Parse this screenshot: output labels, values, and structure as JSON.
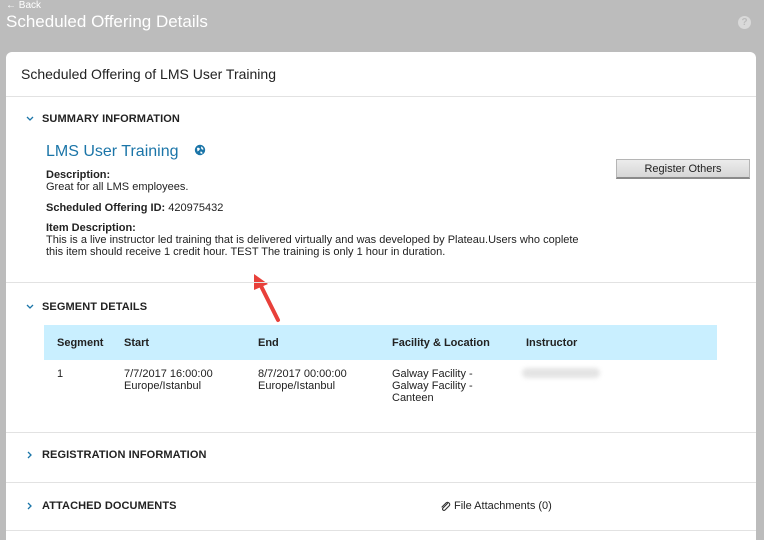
{
  "header": {
    "back_label": "← Back",
    "title": "Scheduled Offering Details",
    "help_icon": "question-circle-icon"
  },
  "card": {
    "title": "Scheduled Offering of LMS User Training"
  },
  "summary": {
    "section_label": "SUMMARY INFORMATION",
    "course_title": "LMS User Training",
    "description_label": "Description:",
    "description": "Great for all LMS employees.",
    "offering_id_label": "Scheduled Offering ID:",
    "offering_id": "420975432",
    "item_desc_label": "Item Description:",
    "item_desc_line1": "This is a live instructor led training that is delivered virtually and was developed by Plateau.Users who coplete",
    "item_desc_line2": "this item should receive 1 credit hour. TEST The training is only 1 hour in duration.",
    "register_button": "Register Others"
  },
  "segments": {
    "section_label": "SEGMENT DETAILS",
    "columns": [
      "Segment",
      "Start",
      "End",
      "Facility & Location",
      "Instructor"
    ],
    "rows": [
      {
        "segment": "1",
        "start_line1": "7/7/2017 16:00:00",
        "start_line2": "Europe/Istanbul",
        "end_line1": "8/7/2017 00:00:00",
        "end_line2": "Europe/Istanbul",
        "facility_line1": "Galway Facility -",
        "facility_line2": "Galway Facility -",
        "facility_line3": "Canteen"
      }
    ]
  },
  "registration": {
    "section_label": "REGISTRATION INFORMATION"
  },
  "documents": {
    "section_label": "ATTACHED DOCUMENTS",
    "attachments_label": "File Attachments (0)"
  },
  "colors": {
    "header_bg": "#bcbcbc",
    "link": "#1b75a8",
    "table_header_bg": "#c9efff",
    "annotation_arrow": "#e8403a"
  }
}
